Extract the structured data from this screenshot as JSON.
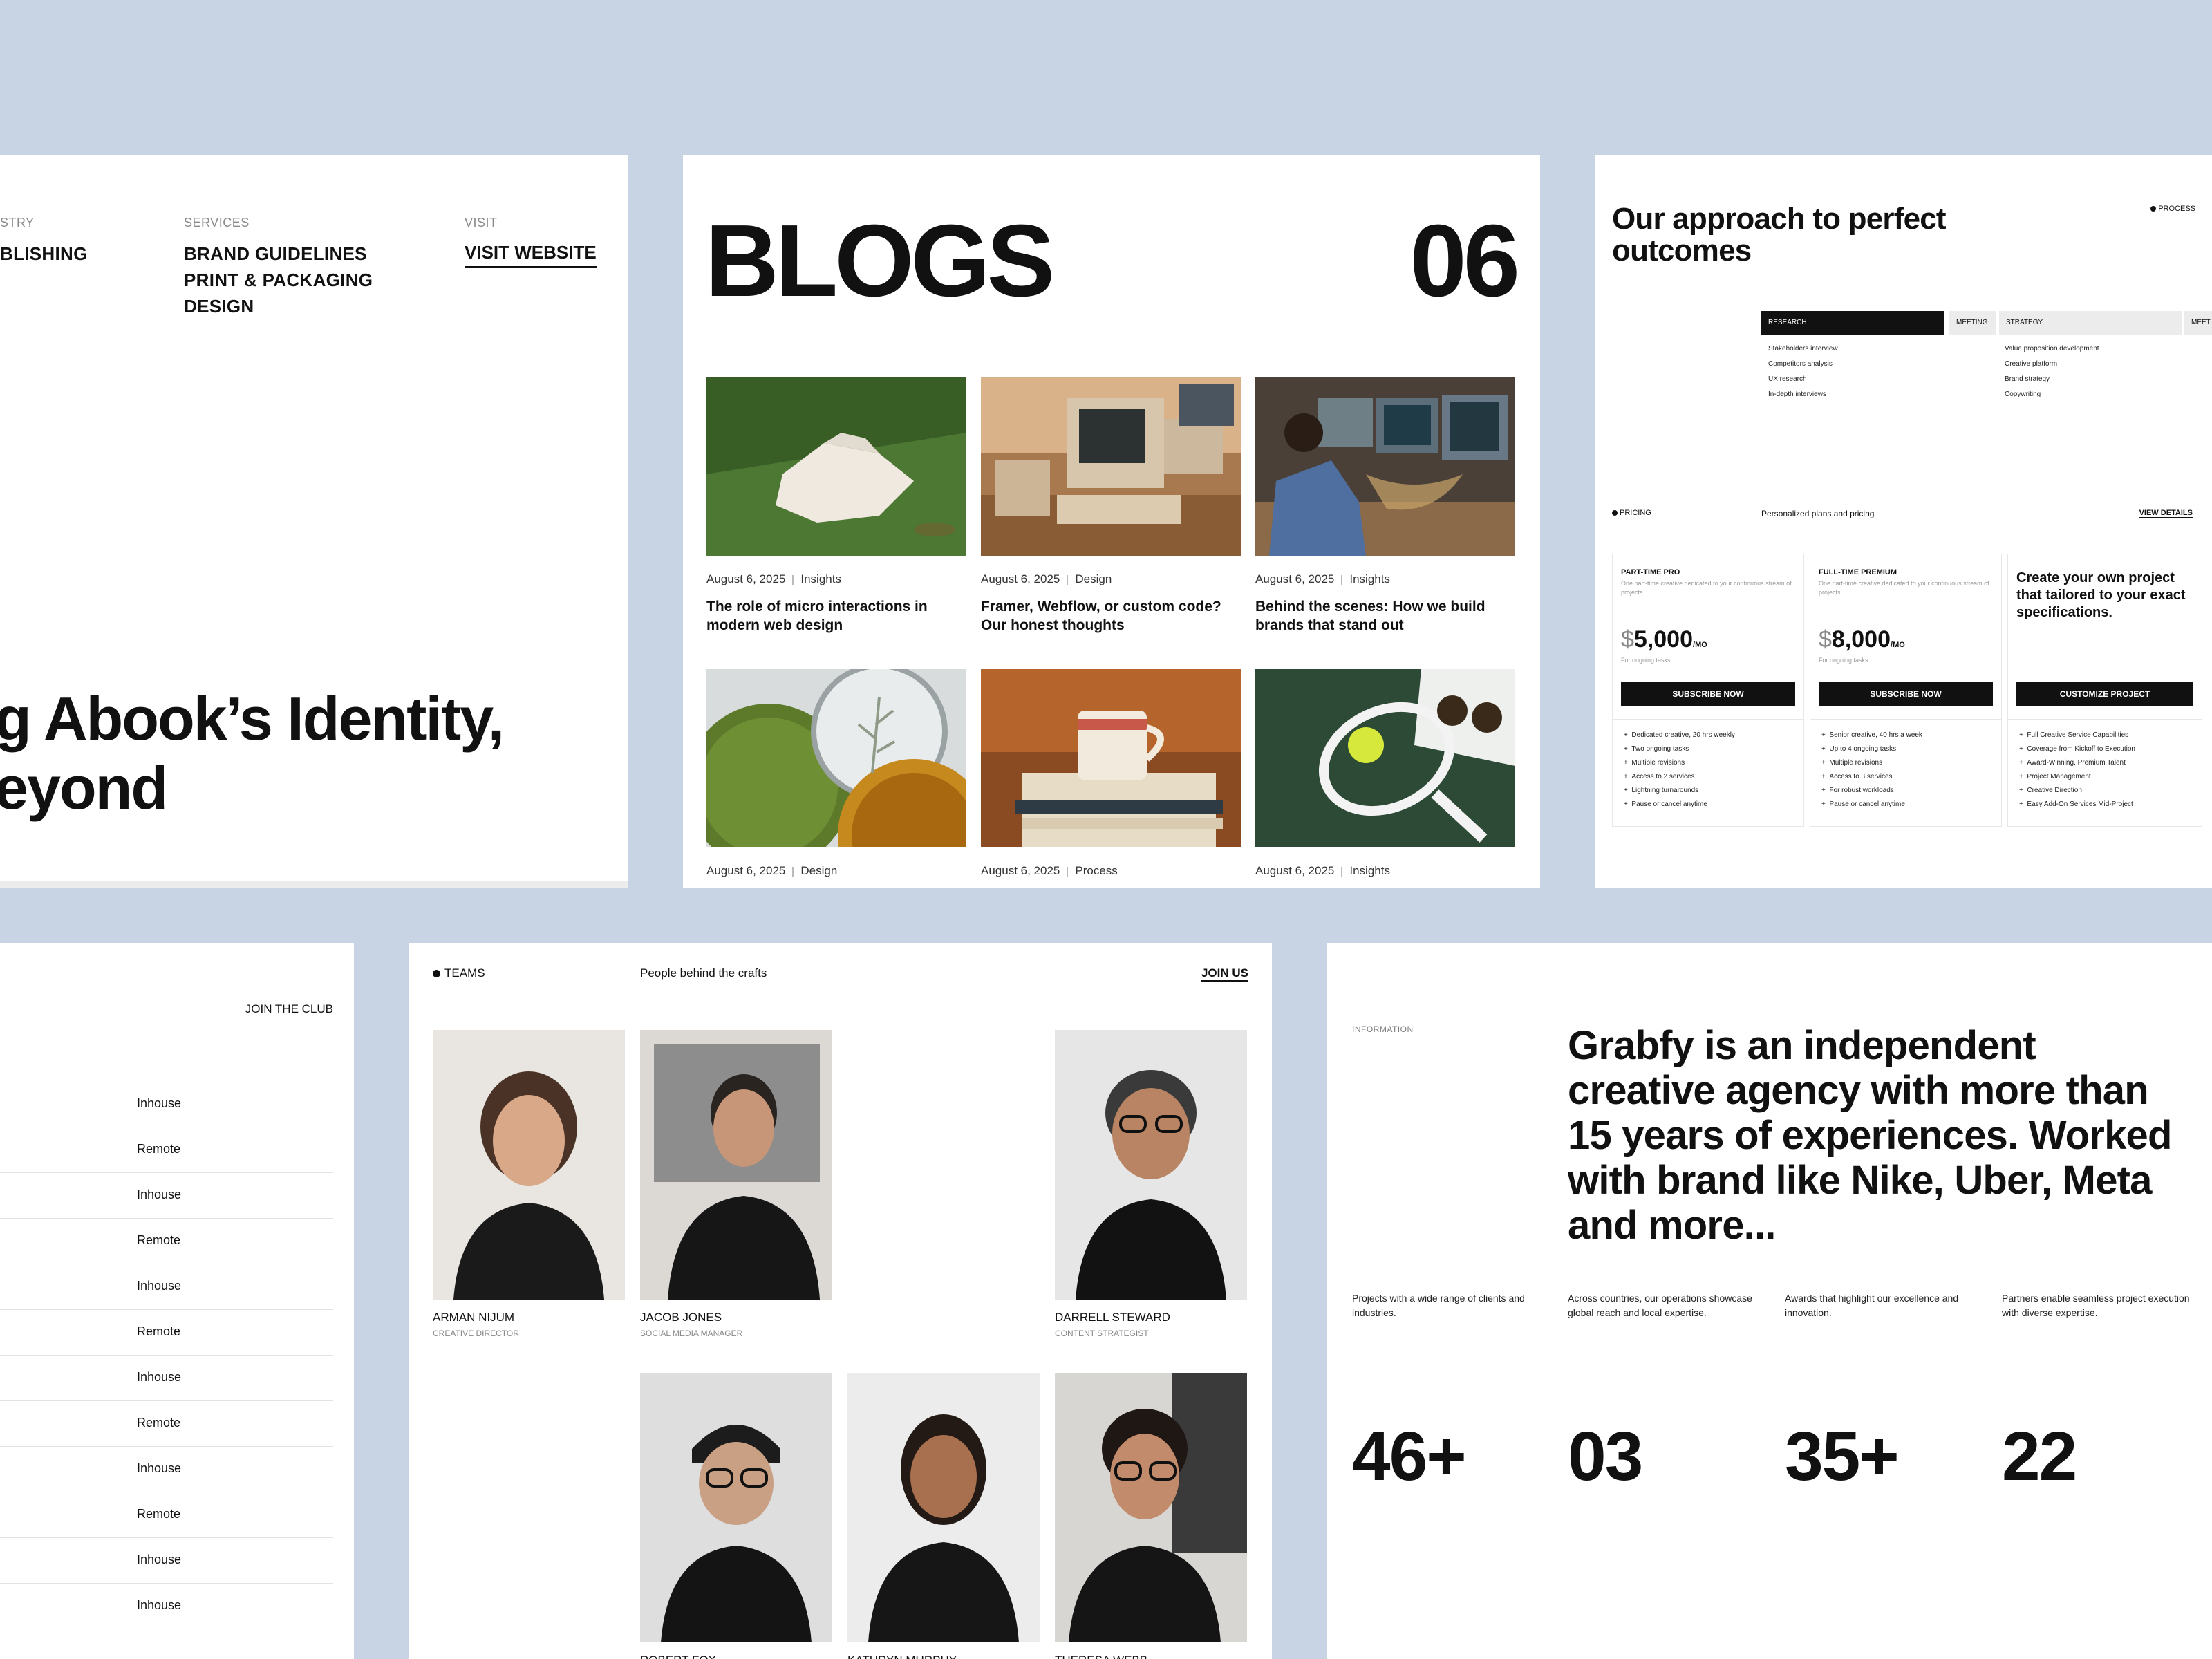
{
  "colors": {
    "background": "#c8d4e3",
    "panel": "#ffffff",
    "text": "#111111",
    "muted": "#8a8a8a"
  },
  "portfolio": {
    "industry_head": "STRY",
    "industry_value": "BLISHING",
    "services_head": "SERVICES",
    "services": [
      "BRAND GUIDELINES",
      "PRINT & PACKAGING",
      "DESIGN"
    ],
    "visit_head": "VISIT",
    "visit_link": "VISIT WEBSITE",
    "hero_line1": "g Abook’s Identity,",
    "hero_line2": "eyond"
  },
  "blogs": {
    "title": "BLOGS",
    "count": "06",
    "posts": [
      {
        "date": "August 6, 2025",
        "category": "Insights",
        "title": "The role of micro interactions in modern web design",
        "image": "shirt-on-grass"
      },
      {
        "date": "August 6, 2025",
        "category": "Design",
        "title": "Framer, Webflow, or custom code? Our honest thoughts",
        "image": "retro-computer"
      },
      {
        "date": "August 6, 2025",
        "category": "Insights",
        "title": "Behind the scenes: How we build brands that stand out",
        "image": "man-at-computers"
      },
      {
        "date": "August 6, 2025",
        "category": "Design",
        "title": "",
        "image": "glass-circles"
      },
      {
        "date": "August 6, 2025",
        "category": "Process",
        "title": "",
        "image": "coffee-cup-books"
      },
      {
        "date": "August 6, 2025",
        "category": "Insights",
        "title": "",
        "image": "tennis-racket"
      }
    ]
  },
  "process": {
    "title": "Our approach to perfect outcomes",
    "tag": "PROCESS",
    "steps": [
      "RESEARCH",
      "MEETING",
      "STRATEGY",
      "MEET"
    ],
    "research_items": [
      "Stakeholders interview",
      "Competitors analysis",
      "UX research",
      "In-depth interviews"
    ],
    "strategy_items": [
      "Value proposition development",
      "Creative platform",
      "Brand strategy",
      "Copywriting"
    ],
    "pricing_tag": "PRICING",
    "pricing_sub": "Personalized plans and pricing",
    "view_details": "VIEW DETAILS",
    "plans": [
      {
        "name": "PART-TIME PRO",
        "desc": "One part-time creative dedicated to your continuous stream of projects.",
        "price_symbol": "$",
        "price": "5,000",
        "period": "/MO",
        "note": "For ongoing tasks.",
        "button": "SUBSCRIBE NOW",
        "features": [
          "Dedicated creative, 20 hrs weekly",
          "Two ongoing tasks",
          "Multiple revisions",
          "Access to 2 services",
          "Lightning turnarounds",
          "Pause or cancel anytime"
        ]
      },
      {
        "name": "FULL-TIME PREMIUM",
        "desc": "One part-time creative dedicated to your continuous stream of projects.",
        "price_symbol": "$",
        "price": "8,000",
        "period": "/MO",
        "note": "For ongoing tasks.",
        "button": "SUBSCRIBE NOW",
        "features": [
          "Senior creative, 40 hrs a week",
          "Up to 4 ongoing tasks",
          "Multiple revisions",
          "Access to 3 services",
          "For robust workloads",
          "Pause or cancel anytime"
        ]
      },
      {
        "name": "Create your own project that tailored to your exact specifications.",
        "button": "CUSTOMIZE PROJECT",
        "features": [
          "Full Creative Service Capabilities",
          "Coverage from Kickoff to Execution",
          "Award-Winning, Premium Talent",
          "Project Management",
          "Creative Direction",
          "Easy Add-On Services Mid-Project"
        ]
      }
    ]
  },
  "careers": {
    "join": "JOIN THE CLUB",
    "jobs": [
      "Inhouse",
      "Remote",
      "Inhouse",
      "Remote",
      "Inhouse",
      "Remote",
      "Inhouse",
      "Remote",
      "Inhouse",
      "Remote",
      "Inhouse",
      "Inhouse"
    ]
  },
  "teams": {
    "tag": "TEAMS",
    "subtitle": "People behind the crafts",
    "join": "JOIN US",
    "members": [
      {
        "name": "ARMAN NIJUM",
        "role": "CREATIVE DIRECTOR"
      },
      {
        "name": "JACOB JONES",
        "role": "SOCIAL MEDIA MANAGER"
      },
      {
        "name": "DARRELL STEWARD",
        "role": "CONTENT STRATEGIST"
      },
      {
        "name": "ROBERT FOX",
        "role": ""
      },
      {
        "name": "KATHRYN MURPHY",
        "role": ""
      },
      {
        "name": "THERESA WEBB",
        "role": ""
      }
    ]
  },
  "info": {
    "tag": "INFORMATION",
    "intro": "Grabfy is an independent creative agency with more than 15 years of experiences. Worked with brand like Nike, Uber, Meta and more...",
    "stats": [
      {
        "desc": "Projects with a wide range of clients and industries.",
        "value": "46+"
      },
      {
        "desc": "Across countries, our operations showcase global reach and local expertise.",
        "value": "03"
      },
      {
        "desc": "Awards that highlight our excellence and innovation.",
        "value": "35+"
      },
      {
        "desc": "Partners enable seamless project execution with diverse expertise.",
        "value": "22"
      }
    ]
  }
}
